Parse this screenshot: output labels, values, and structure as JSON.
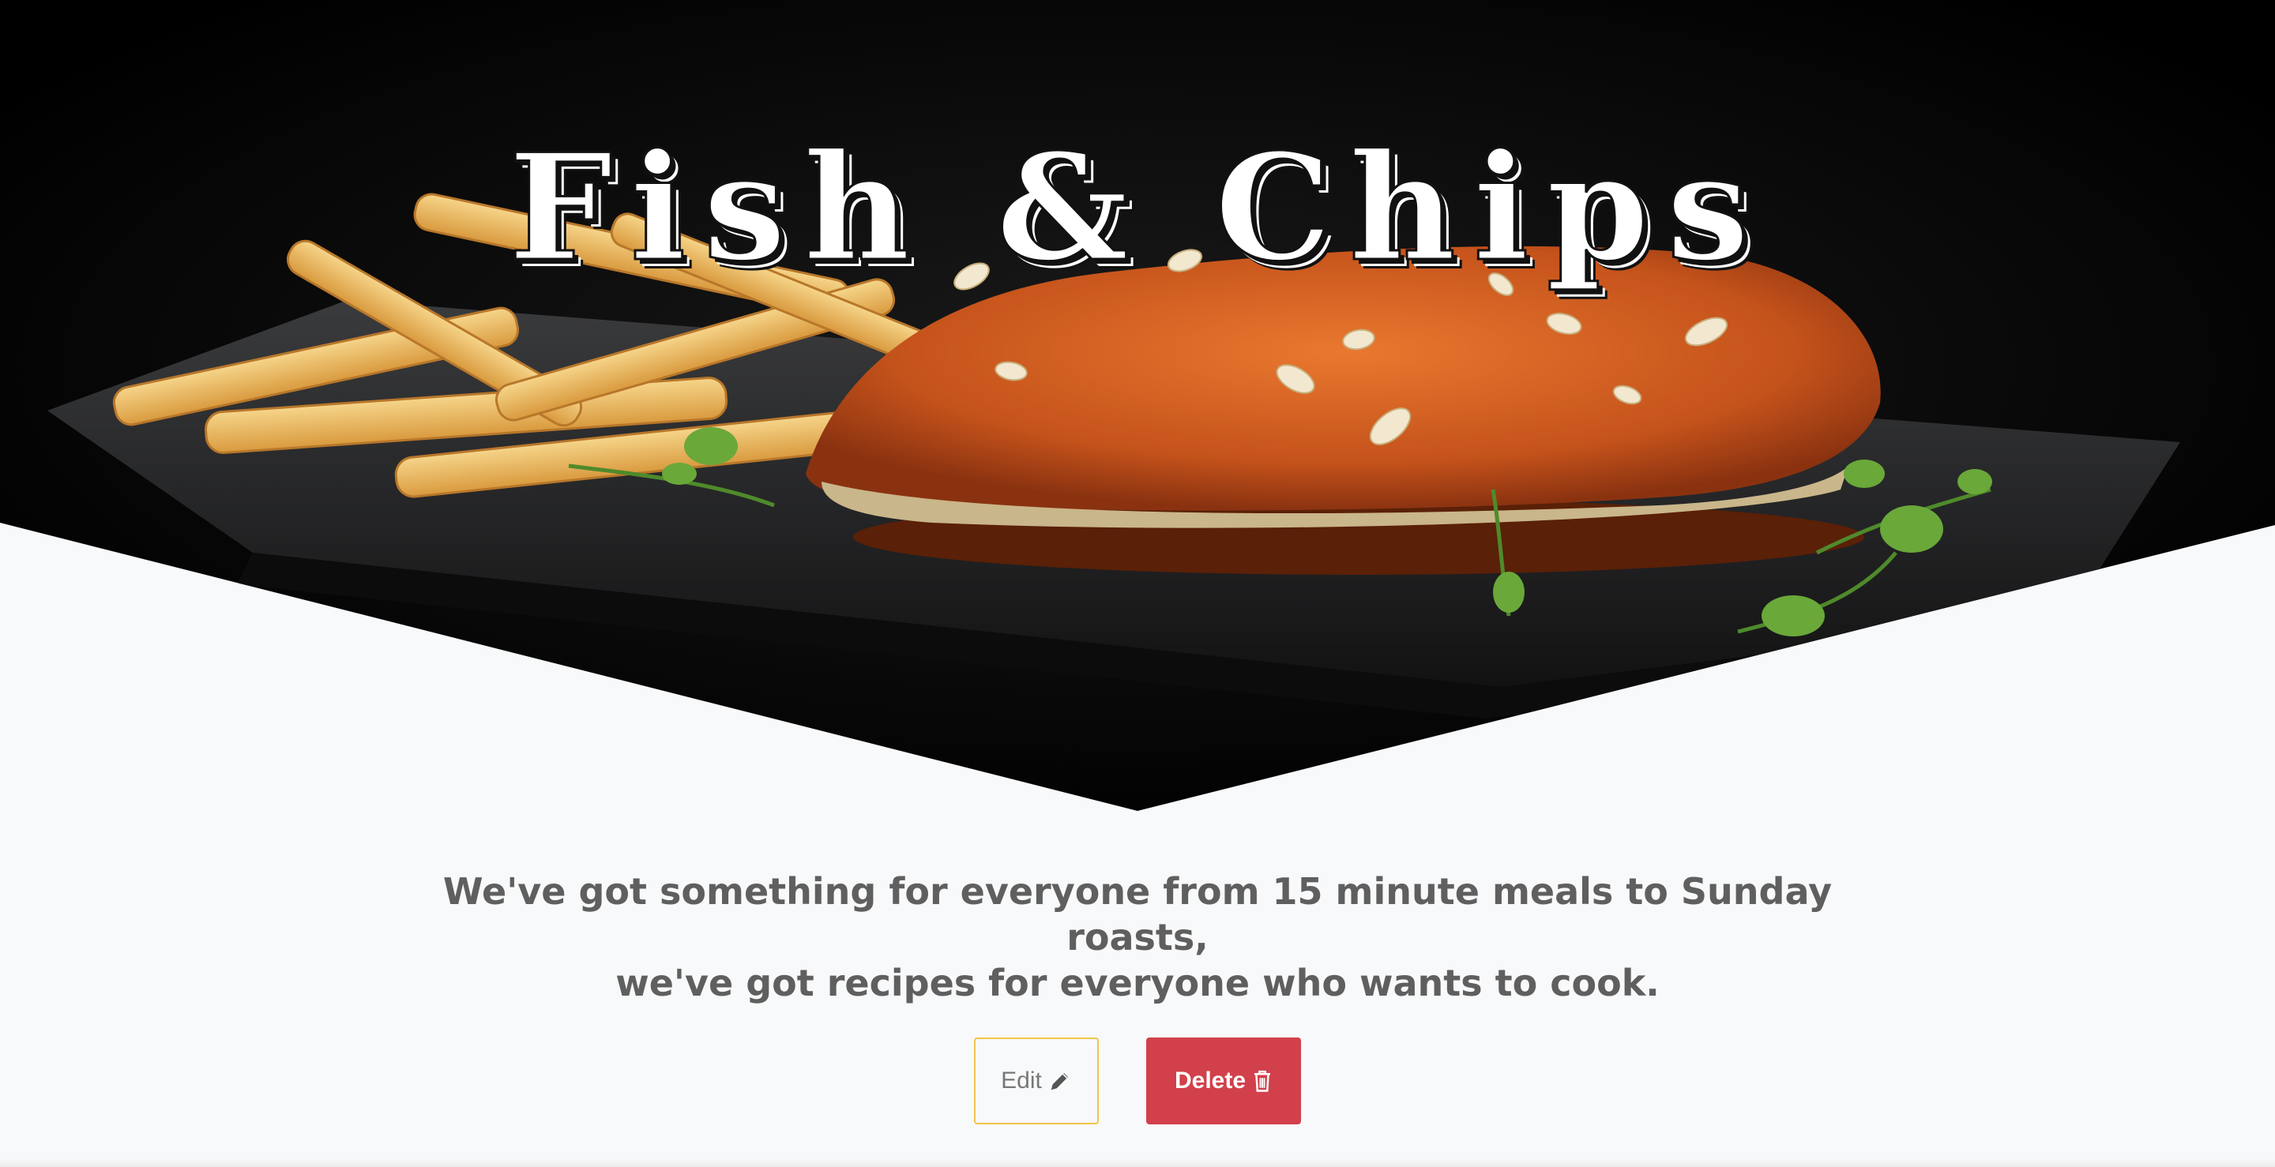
{
  "hero": {
    "title": "Fish & Chips"
  },
  "tagline": {
    "line1": "We've got something for everyone from 15 minute meals to Sunday roasts,",
    "line2": "we've got recipes for everyone who wants to cook."
  },
  "actions": {
    "edit_label": "Edit",
    "delete_label": "Delete"
  },
  "icons": {
    "edit": "pencil-icon",
    "delete": "trash-icon"
  },
  "colors": {
    "page_background": "#f8f9fa",
    "edit_border": "#f0c54a",
    "delete_background": "#d2404b",
    "tagline_text": "#5f5f5f"
  }
}
